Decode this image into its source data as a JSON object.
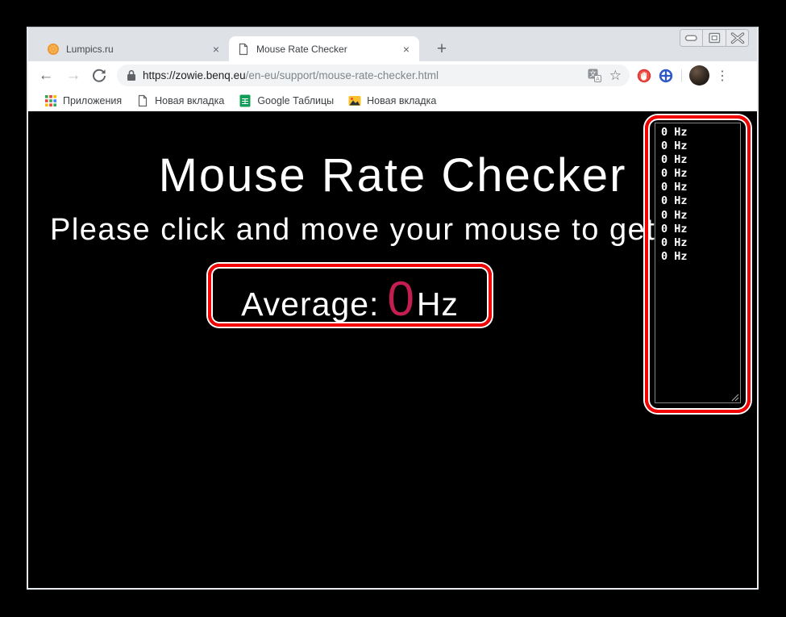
{
  "browser": {
    "window_controls": {
      "minimize": "minimize-button",
      "maximize": "maximize-button",
      "close": "close-button"
    },
    "tabs": [
      {
        "title": "Lumpics.ru",
        "favicon": "orange-fruit-icon"
      },
      {
        "title": "Mouse Rate Checker",
        "favicon": "blank-page-icon",
        "active": true
      }
    ],
    "glyphs": {
      "close_tab": "×",
      "new_tab": "+",
      "back": "←",
      "forward": "→",
      "star": "☆",
      "menu": "⋮"
    },
    "url": {
      "host": "https://zowie.benq.eu",
      "path": "/en-eu/support/mouse-rate-checker.html"
    },
    "toolbar_icons": [
      "back-icon",
      "forward-icon",
      "reload-icon",
      "lock-icon",
      "translate-icon",
      "star-icon",
      "hand-extension-icon",
      "globe-extension-icon",
      "avatar",
      "menu-dots-icon"
    ],
    "bookmarks_bar": {
      "items": [
        {
          "label": "Приложения",
          "icon": "apps-grid-icon"
        },
        {
          "label": "Новая вкладка",
          "icon": "blank-page-icon"
        },
        {
          "label": "Google Таблицы",
          "icon": "google-sheets-icon"
        },
        {
          "label": "Новая вкладка",
          "icon": "photo-icon"
        }
      ]
    }
  },
  "page": {
    "heading": "Mouse Rate Checker",
    "subtitle": "Please click and move your mouse to get",
    "average": {
      "label": "Average: ",
      "value": "0",
      "unit": "Hz"
    },
    "readings": [
      "0 Hz",
      "0 Hz",
      "0 Hz",
      "0 Hz",
      "0 Hz",
      "0 Hz",
      "0 Hz",
      "0 Hz",
      "0 Hz",
      "0 Hz"
    ],
    "colors": {
      "page_background": "#000000",
      "annotation_red": "#f50000",
      "average_value_crimson": "#c41e50",
      "heading_text": "#ffffff"
    }
  }
}
